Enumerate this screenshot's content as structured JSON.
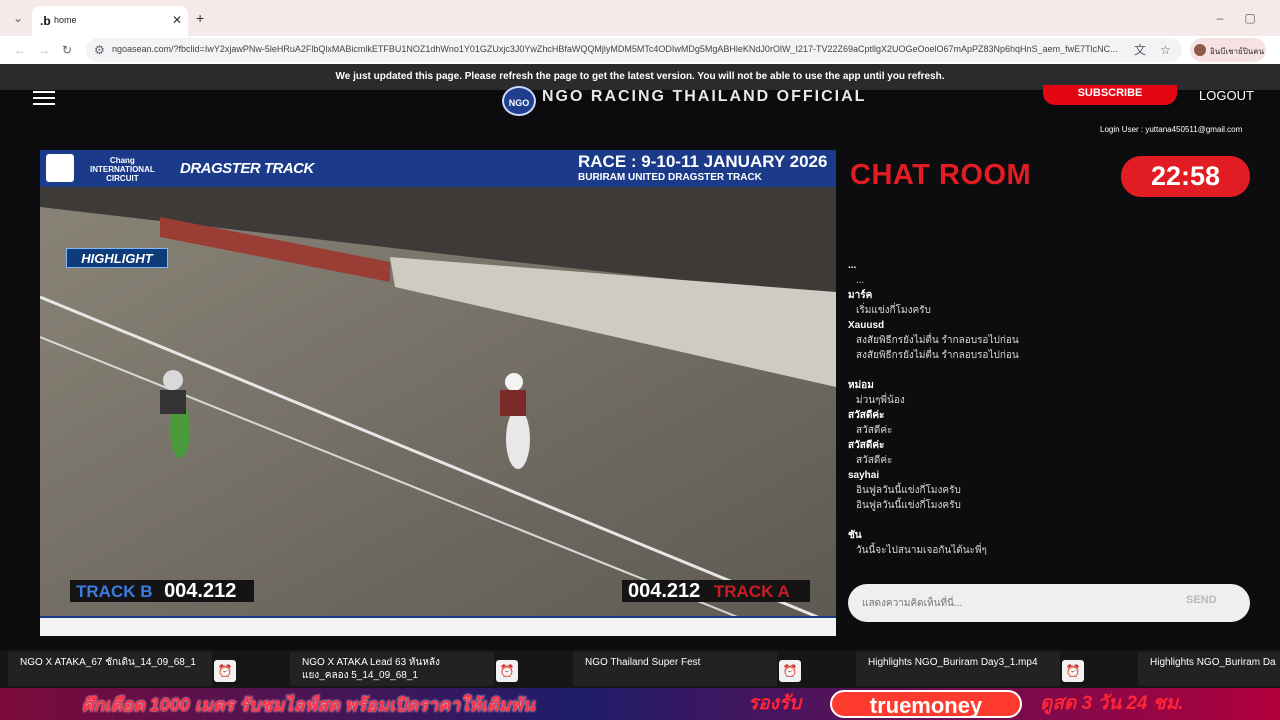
{
  "browser": {
    "tab_title": "home",
    "tab_favicon": ".b",
    "url": "ngoasean.com/?fbclid=IwY2xjawPNw-5leHRuA2FlbQlxMABicmlkETFBU1NOZ1dhWno1Y01GZUxjc3J0YwZhcHBfaWQQMjlyMDM5MTc4ODIwMDg5MgABHleKNdJ0rOlW_I217-TV22Z69aCptllgX2UOGeOoelO67mApPZ83Np6hqHnS_aem_fwE7TlcNC...",
    "profile_label": "อินบีเชาย์ปินคน"
  },
  "banner": {
    "text": "We just updated this page. Please refresh the page to get the latest version. You will not be able to use the app until you refresh."
  },
  "header": {
    "title": "NGO RACING THAILAND OFFICIAL",
    "logo": "NGO",
    "subscribe": "SUBSCRIBE",
    "logout": "LOGOUT",
    "login_user": "Login User : yuttana450511@gmail.com"
  },
  "video": {
    "race_title": "RACE : 9-10-11 JANUARY 2026",
    "race_subtitle": "BURIRAM UNITED DRAGSTER TRACK",
    "chang": "Chang\nINTERNATIONAL\nCIRCUIT",
    "dragster": "DRAGSTER TRACK",
    "highlight": "HIGHLIGHT",
    "track_b_label": "TRACK B",
    "track_b_time": "004.212",
    "track_a_label": "TRACK A",
    "track_a_time": "004.212"
  },
  "chat": {
    "title": "CHAT ROOM",
    "timer": "22:58",
    "placeholder": "แสดงความคิดเห็นที่นี่...",
    "send": "SEND",
    "messages": [
      {
        "user": "...",
        "lines": [
          "..."
        ]
      },
      {
        "user": "มาร์ค",
        "lines": [
          "เริ่มแข่งกี่โมงครับ"
        ]
      },
      {
        "user": "Xauusd",
        "lines": [
          "สงสัยพิธีกรยังไม่ตื่น รำกลอบรอไปก่อน",
          "สงสัยพิธีกรยังไม่ตื่น รำกลอบรอไปก่อน"
        ]
      },
      {
        "user": "หม่อม",
        "lines": [
          "ม่วนๆพี่น้อง"
        ]
      },
      {
        "user": "สวัสดีค่ะ",
        "lines": [
          "สวัสดีค่ะ"
        ]
      },
      {
        "user": "สวัสดีค่ะ",
        "lines": [
          "สวัสดีค่ะ"
        ]
      },
      {
        "user": "sayhai",
        "lines": [
          "อินฟูลวันนี้แข่งกี่โมงครับ",
          "อินฟูลวันนี้แข่งกี่โมงครับ"
        ]
      },
      {
        "user": "ชัน",
        "lines": [
          "วันนี้จะไปสนามเจอกันได้นะพี่ๆ"
        ]
      }
    ]
  },
  "playlist": [
    {
      "title": "NGO X ATAKA_67 ชักเดิน_14_09_68_1",
      "sub": ""
    },
    {
      "title": "NGO X ATAKA Lead 63 หันหลัง",
      "sub": "แยง_คลอง 5_14_09_68_1"
    },
    {
      "title": "NGO Thailand Super Fest",
      "sub": ""
    },
    {
      "title": "Highlights NGO_Buriram Day3_1.mp4",
      "sub": ""
    },
    {
      "title": "Highlights NGO_Buriram Da",
      "sub": ""
    }
  ],
  "ticker": {
    "left": "ศึกเดือด 1000 เมตร รับชมไลฟ์สด พร้อมเปิดราคาให้เดิมพัน",
    "right": "รองรับ",
    "brand": "truemoney",
    "end": "ดูสด 3 วัน 24 ชม."
  },
  "colors": {
    "accent_red": "#e31b23",
    "video_blue": "#1b3a8a",
    "background": "#0d0d0f"
  }
}
